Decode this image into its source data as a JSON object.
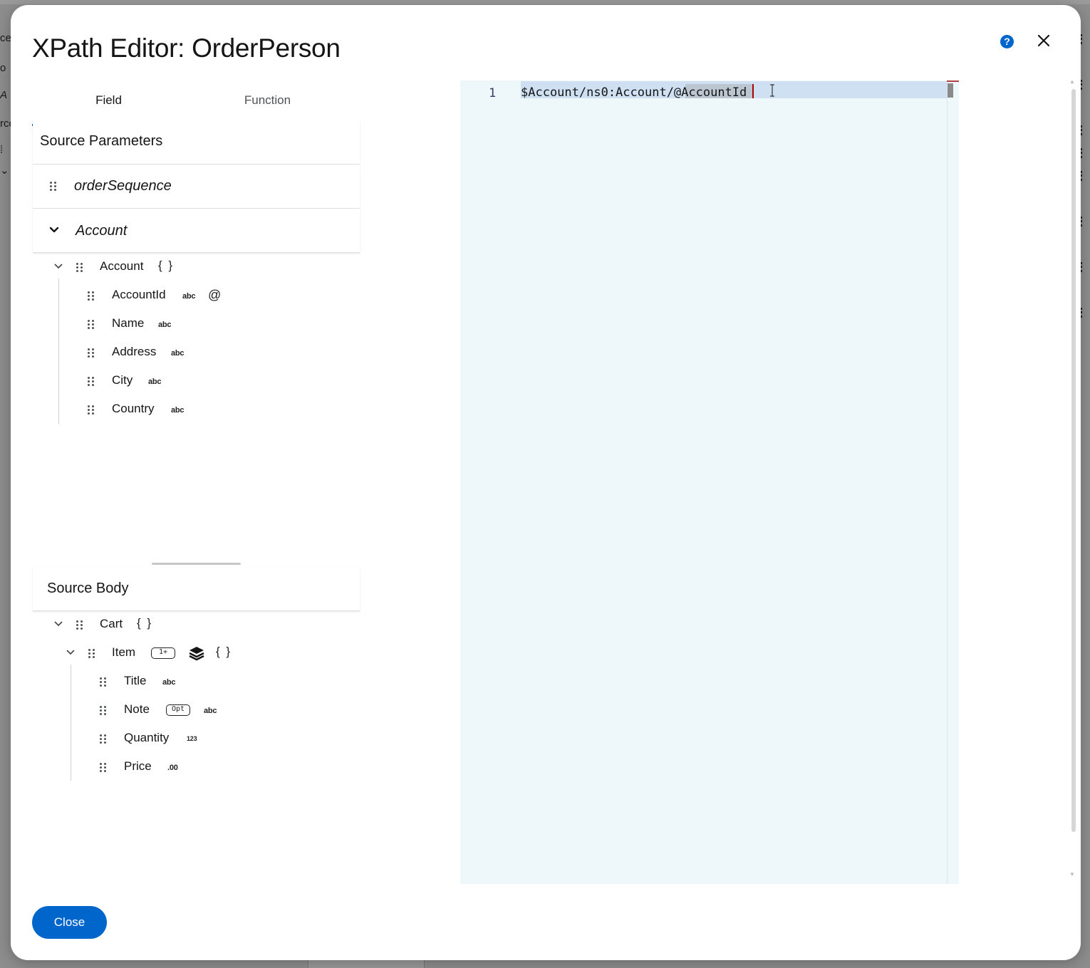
{
  "modal": {
    "title": "XPath Editor: OrderPerson",
    "help_icon": "question-circle-icon",
    "close_icon": "close-icon",
    "help_glyph": "?"
  },
  "tabs": [
    {
      "label": "Field",
      "active": true
    },
    {
      "label": "Function",
      "active": false
    }
  ],
  "source_parameters": {
    "header": "Source Parameters",
    "params": [
      {
        "label": "orderSequence"
      },
      {
        "label": "Account",
        "expanded": true
      }
    ],
    "tree": {
      "root": {
        "label": "Account",
        "braces": "{ }"
      },
      "children": [
        {
          "label": "AccountId",
          "type": "abc",
          "attribute": "@"
        },
        {
          "label": "Name",
          "type": "abc"
        },
        {
          "label": "Address",
          "type": "abc"
        },
        {
          "label": "City",
          "type": "abc"
        },
        {
          "label": "Country",
          "type": "abc"
        }
      ]
    }
  },
  "source_body": {
    "header": "Source Body",
    "tree": {
      "root": {
        "label": "Cart",
        "braces": "{ }"
      },
      "item": {
        "label": "Item",
        "badge": "1+",
        "braces": "{ }",
        "icon": "layer-group-icon"
      },
      "children": [
        {
          "label": "Title",
          "type": "abc"
        },
        {
          "label": "Note",
          "badge": "Opt",
          "type": "abc"
        },
        {
          "label": "Quantity",
          "type": "123"
        },
        {
          "label": "Price",
          "type": ".00"
        }
      ]
    }
  },
  "editor": {
    "line_number": "1",
    "code": "$Account/ns0:Account/@AccountId",
    "background": "#eef7fa"
  },
  "footer": {
    "close_label": "Close"
  },
  "colors": {
    "accent": "#0066cc"
  }
}
